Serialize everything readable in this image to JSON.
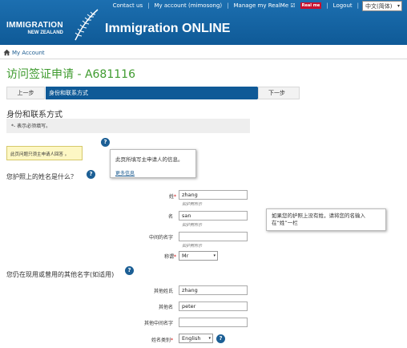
{
  "header": {
    "links": {
      "contact": "Contact us",
      "account": "My account (mimosong)",
      "realme": "Manage my RealMe ☑",
      "realme_badge": "Real me",
      "logout": "Logout"
    },
    "language": "中文(简体)",
    "logo_line1": "IMMIGRATION",
    "logo_line2": "NEW ZEALAND",
    "app_title": "Immigration ONLINE"
  },
  "breadcrumb": {
    "label": "My Account"
  },
  "page": {
    "title": "访问签证申请 - A681116",
    "prev_label": "上一步",
    "current_step": "身份和联系方式",
    "next_label": "下一步",
    "section_title": "身份和联系方式",
    "required_note": "*- 表示必须填写。",
    "required_star": "*",
    "principal_note": "此页问题只须主申请人回答 。"
  },
  "tooltip1": {
    "text": "此页所填写主申请人的信息。",
    "more_link": "更多信息"
  },
  "passport_question": "您护照上的姓名是什么？",
  "name_fields": {
    "surname_label": "姓",
    "surname_value": "zhang",
    "surname_hint": "如护照所示",
    "given_label": "名",
    "given_value": "san",
    "given_hint": "如护照所示",
    "middle_label": "中间的名字",
    "middle_value": "",
    "middle_hint": "如护照所示",
    "title_label": "称谓",
    "title_value": "Mr"
  },
  "tooltip2": {
    "text": "如果您的护照上没有姓，请将您的名输入在“姓”一栏"
  },
  "other_names_question": "您仍在现用或曾用的其他名字(如适用)",
  "other_fields": {
    "other_surname_label": "其他姓氏",
    "other_surname_value": "zhang",
    "other_given_label": "其他名",
    "other_given_value": "peter",
    "other_middle_label": "其他中间名字",
    "other_middle_value": "",
    "name_type_label": "姓名类别",
    "name_type_value": "English"
  },
  "help_icon_glyph": "?",
  "select_arrow_glyph": "▾",
  "colors": {
    "header_blue": "#0f5a97",
    "title_green": "#3f9b2f",
    "required_red": "#cc0000",
    "note_yellow": "#fdf7c4"
  },
  "icons": {
    "home": "home-icon",
    "help": "help-icon",
    "fern": "fern-logo-icon"
  }
}
